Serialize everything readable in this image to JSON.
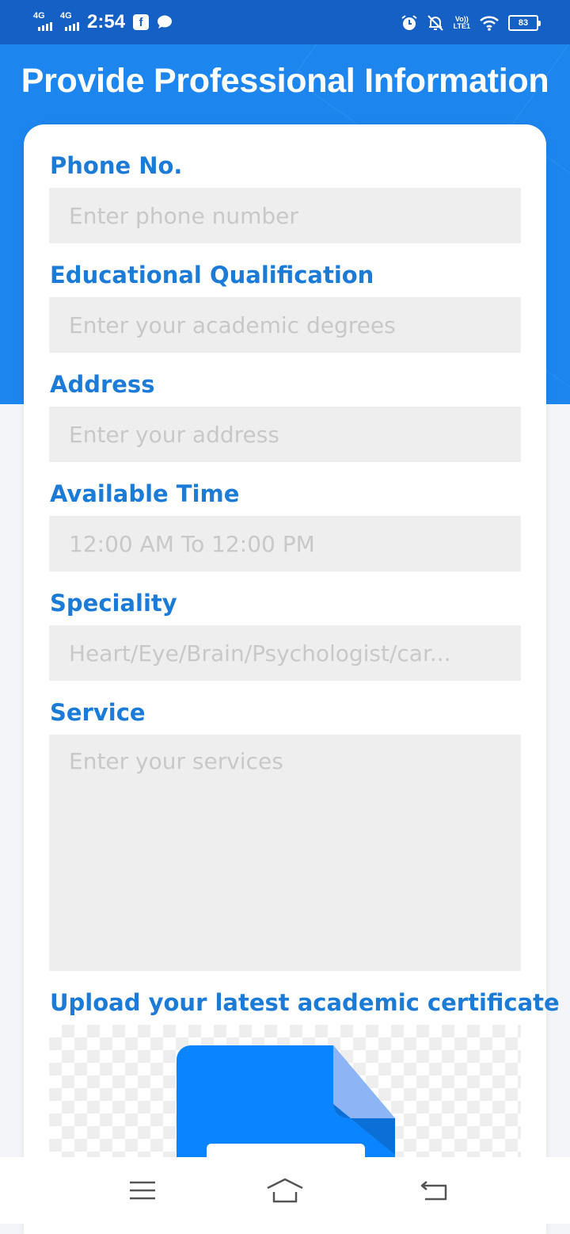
{
  "status_bar": {
    "network_1": "4G",
    "network_2": "4G",
    "time": "2:54",
    "volte_line1": "Vo))",
    "volte_line2": "LTE1",
    "battery": "83",
    "icons": [
      "signal-icon",
      "facebook-icon",
      "message-icon",
      "alarm-icon",
      "mute-icon",
      "wifi-icon",
      "battery-icon"
    ]
  },
  "header": {
    "title": "Provide Professional Information"
  },
  "form": {
    "phone": {
      "label": "Phone No.",
      "placeholder": "Enter phone number",
      "value": ""
    },
    "education": {
      "label": "Educational Qualification",
      "placeholder": "Enter your academic degrees",
      "value": ""
    },
    "address": {
      "label": "Address",
      "placeholder": "Enter your address",
      "value": ""
    },
    "available_time": {
      "label": "Available Time",
      "placeholder": "12:00 AM To 12:00 PM",
      "value": ""
    },
    "speciality": {
      "label": "Speciality",
      "placeholder": "Heart/Eye/Brain/Psychologist/car...",
      "value": ""
    },
    "service": {
      "label": "Service",
      "placeholder": "Enter your services",
      "value": ""
    },
    "certificate": {
      "label": "Upload your latest academic certificate",
      "icon": "document-upload-icon"
    }
  },
  "nav": {
    "icons": [
      "menu-icon",
      "home-icon",
      "back-icon"
    ]
  },
  "colors": {
    "status_bar": "#1560c4",
    "header": "#1d86ee",
    "label": "#1b7bd6",
    "input_bg": "#eeeeee",
    "placeholder": "#c8c8c8",
    "doc_blue": "#0a84ff",
    "doc_fold": "#8db5f5"
  }
}
